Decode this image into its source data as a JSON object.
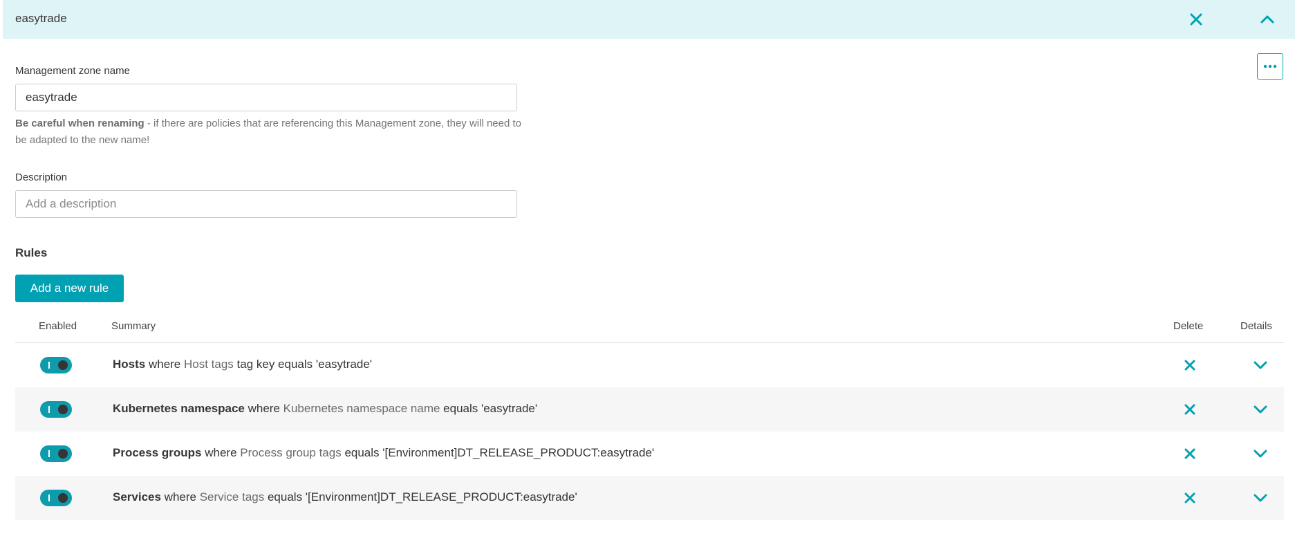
{
  "header": {
    "title": "easytrade"
  },
  "form": {
    "name_label": "Management zone name",
    "name_value": "easytrade",
    "hint_bold": "Be careful when renaming",
    "hint_rest": " - if there are policies that are referencing this Management zone, they will need to be adapted to the new name!",
    "description_label": "Description",
    "description_value": "",
    "description_placeholder": "Add a description"
  },
  "rules": {
    "title": "Rules",
    "add_label": "Add a new rule",
    "headers": {
      "enabled": "Enabled",
      "summary": "Summary",
      "delete": "Delete",
      "details": "Details"
    },
    "items": [
      {
        "enabled": true,
        "entity": "Hosts",
        "where": " where ",
        "attr": "Host tags",
        "cond": " tag key equals 'easytrade'"
      },
      {
        "enabled": true,
        "entity": "Kubernetes namespace",
        "where": " where ",
        "attr": "Kubernetes namespace name",
        "cond": " equals 'easytrade'"
      },
      {
        "enabled": true,
        "entity": "Process groups",
        "where": " where ",
        "attr": "Process group tags",
        "cond": " equals '[Environment]DT_RELEASE_PRODUCT:easytrade'"
      },
      {
        "enabled": true,
        "entity": "Services",
        "where": " where ",
        "attr": "Service tags",
        "cond": " equals '[Environment]DT_RELEASE_PRODUCT:easytrade'"
      }
    ]
  },
  "icons": {
    "close": "close-icon",
    "collapse": "chevron-up-icon",
    "more": "more-horizontal-icon",
    "expand": "chevron-down-icon"
  },
  "colors": {
    "accent": "#00a1b2",
    "header_bg": "#dff4f7",
    "toggle_on": "#0e9bab"
  }
}
